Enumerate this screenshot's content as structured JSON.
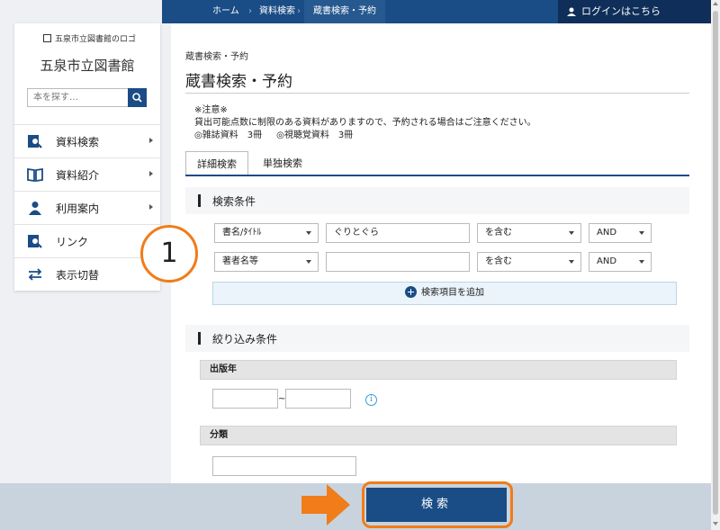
{
  "breadcrumb": {
    "home": "ホーム",
    "search": "資料検索",
    "current": "蔵書検索・予約"
  },
  "login": {
    "label": "ログインはこちら"
  },
  "sidebar": {
    "logo_alt": "五泉市立図書館のロゴ",
    "library_name": "五泉市立図書館",
    "search_placeholder": "本を探す…",
    "items": [
      {
        "label": "資料検索",
        "icon": "search-doc-icon"
      },
      {
        "label": "資料紹介",
        "icon": "open-book-icon"
      },
      {
        "label": "利用案内",
        "icon": "user-icon"
      },
      {
        "label": "リンク",
        "icon": "link-icon"
      },
      {
        "label": "表示切替",
        "icon": "switch-arrows-icon"
      }
    ]
  },
  "main": {
    "sub_crumb": "蔵書検索・予約",
    "title": "蔵書検索・予約",
    "notice": {
      "heading": "※注意※",
      "body": "貸出可能点数に制限のある資料がありますので、予約される場合はご注意ください。",
      "item1": "◎雑誌資料　3冊",
      "item2": "◎視聴覚資料　3冊"
    },
    "tabs": [
      {
        "label": "詳細検索"
      },
      {
        "label": "単独検索"
      }
    ],
    "conditions": {
      "heading": "検索条件",
      "rows": [
        {
          "field": "書名/ﾀｲﾄﾙ",
          "value": "ぐりとぐら",
          "match": "を含む",
          "op": "AND"
        },
        {
          "field": "著者名等",
          "value": "",
          "match": "を含む",
          "op": "AND"
        }
      ],
      "add_label": "検索項目を追加"
    },
    "filters": {
      "heading": "絞り込み条件",
      "pub_year": "出版年",
      "range_sep": "~",
      "info": "i",
      "classification": "分類"
    }
  },
  "footer": {
    "submit": "検索"
  },
  "annotation": {
    "step": "1"
  },
  "colors": {
    "brand": "#1a4c86",
    "accent": "#f07c1a",
    "remove": "#e05a2b"
  }
}
